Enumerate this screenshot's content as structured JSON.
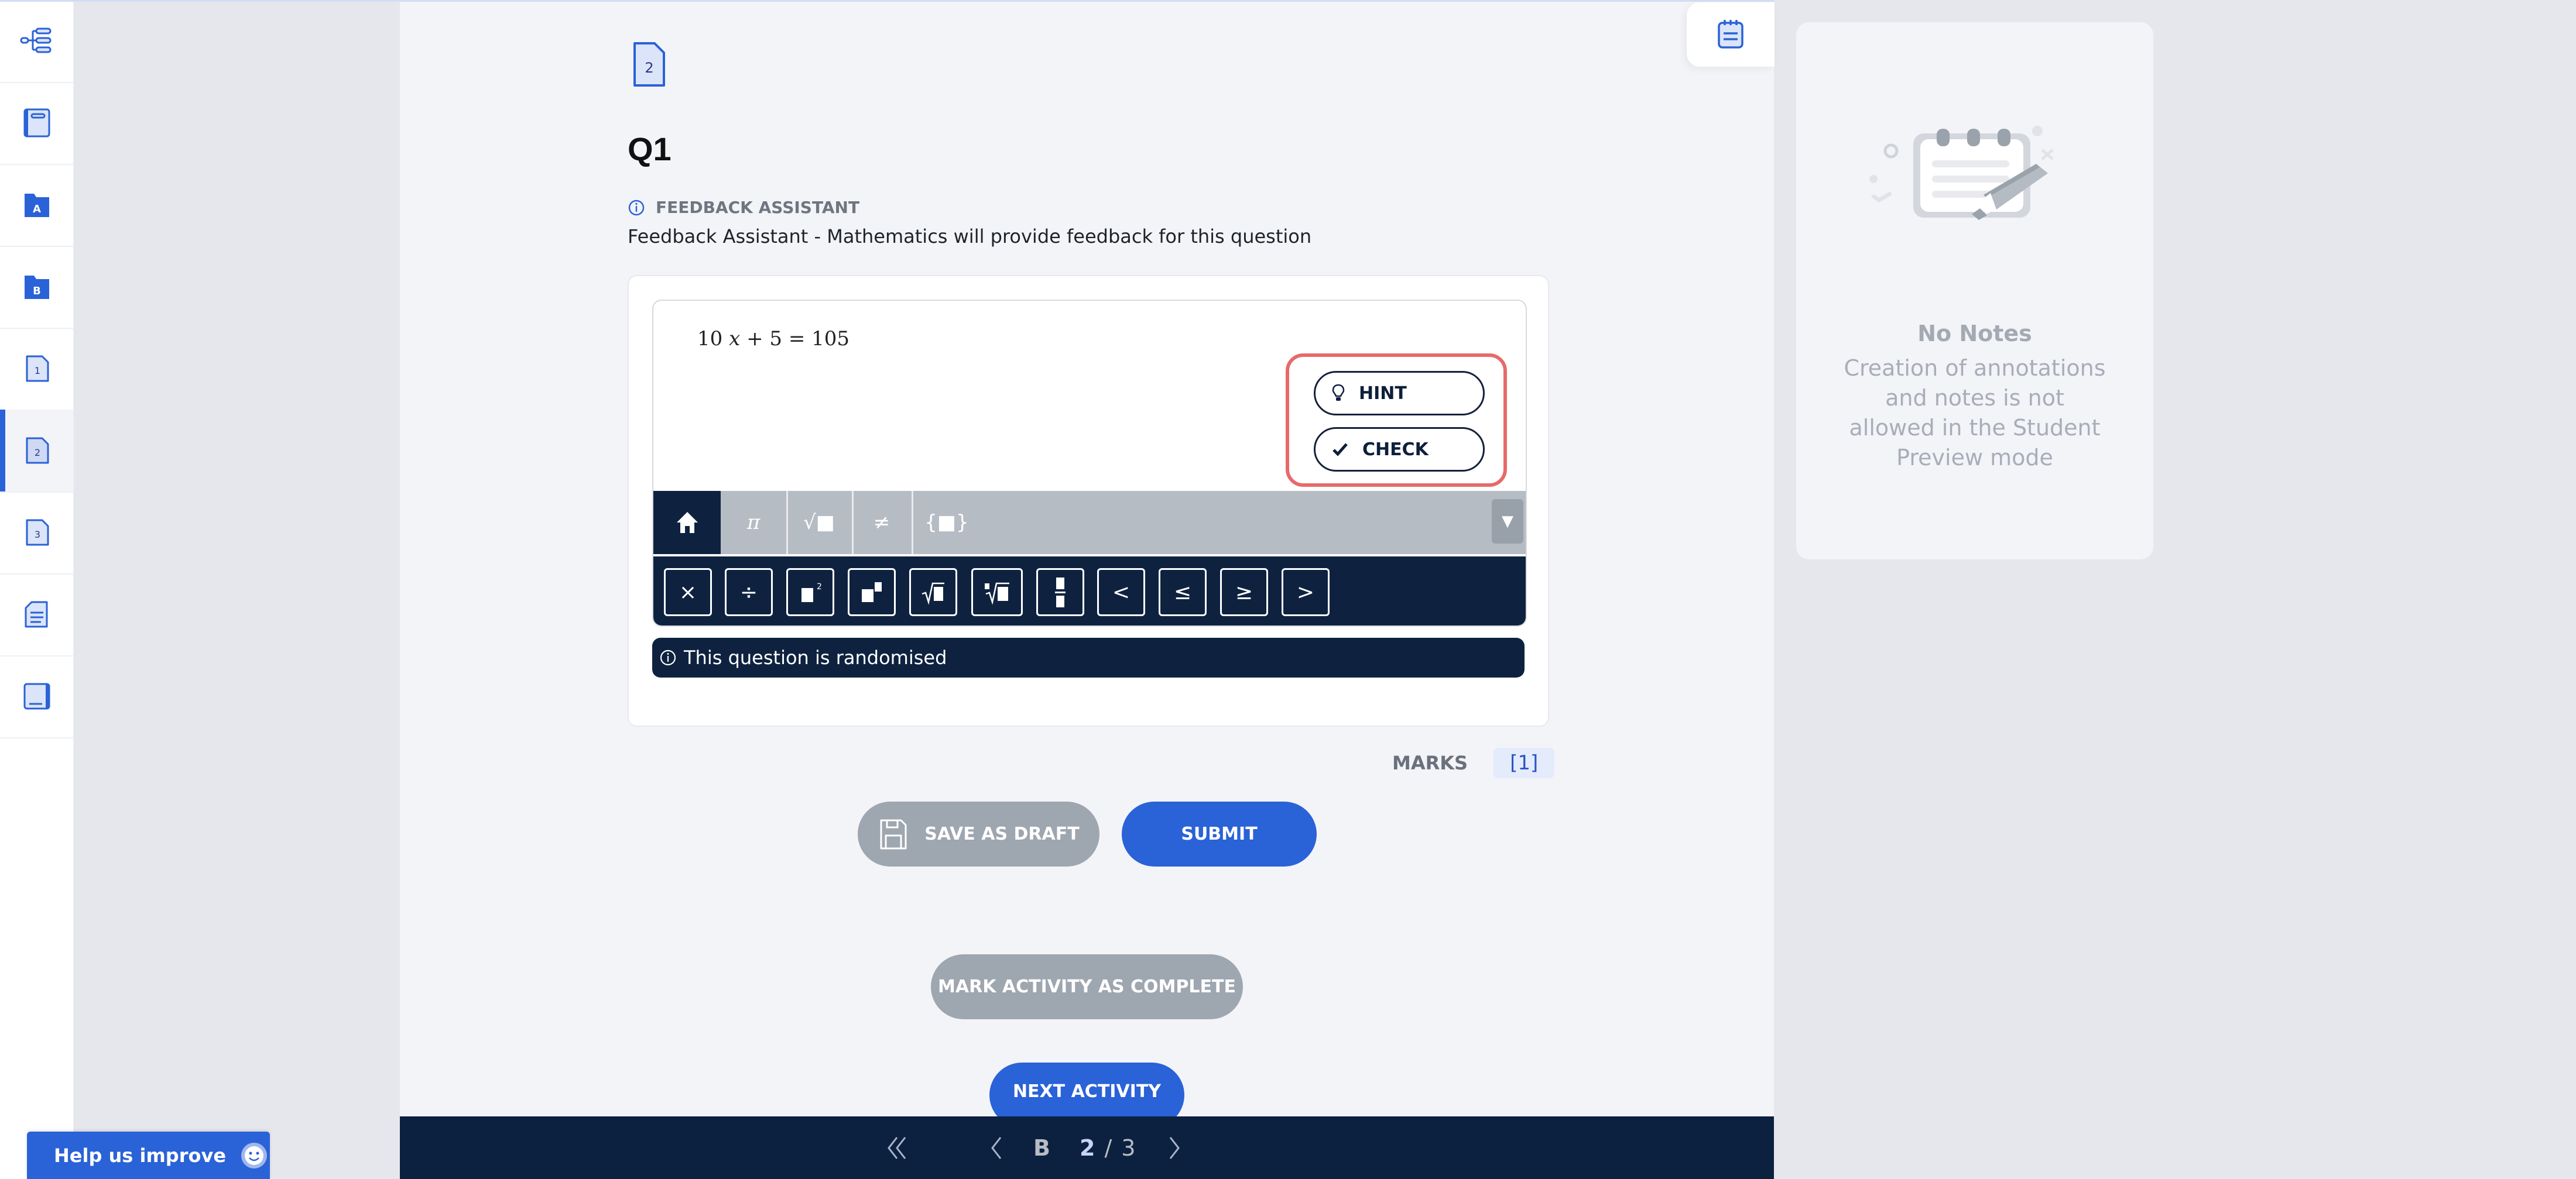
{
  "sidebar": {
    "items": [
      {
        "icon": "structure-tree-icon",
        "label": ""
      },
      {
        "icon": "book-icon",
        "label": ""
      },
      {
        "icon": "folder-a-icon",
        "label": "A"
      },
      {
        "icon": "folder-b-icon",
        "label": "B"
      },
      {
        "icon": "page-1-icon",
        "label": "1"
      },
      {
        "icon": "page-2-icon",
        "label": "2",
        "active": true
      },
      {
        "icon": "page-3-icon",
        "label": "3"
      },
      {
        "icon": "document-lines-icon",
        "label": ""
      },
      {
        "icon": "closed-book-icon",
        "label": ""
      }
    ]
  },
  "page": {
    "page_icon_label": "2",
    "question_title": "Q1",
    "feedback_label": "FEEDBACK ASSISTANT",
    "feedback_description": "Feedback Assistant - Mathematics will provide feedback for this question"
  },
  "editor": {
    "expression": {
      "coef": "10",
      "var": "x",
      "rest": "+ 5 = 105"
    },
    "hint_label": "HINT",
    "check_label": "CHECK",
    "tabs": [
      {
        "name": "home",
        "glyph": "⌂"
      },
      {
        "name": "pi",
        "glyph": "π"
      },
      {
        "name": "sqrt",
        "glyph": "√■"
      },
      {
        "name": "not-equal",
        "glyph": "≠"
      },
      {
        "name": "set-braces",
        "glyph": "{■}"
      }
    ],
    "dropdown_glyph": "▼",
    "keys": [
      {
        "name": "times",
        "glyph": "×"
      },
      {
        "name": "divide",
        "glyph": "÷"
      },
      {
        "name": "square",
        "glyph": "■²"
      },
      {
        "name": "power",
        "glyph": "■■"
      },
      {
        "name": "square-root",
        "glyph": "√■"
      },
      {
        "name": "nth-root",
        "glyph": "ⁿ√■"
      },
      {
        "name": "fraction",
        "glyph": "▬"
      },
      {
        "name": "less-than",
        "glyph": "<"
      },
      {
        "name": "less-equal",
        "glyph": "≤"
      },
      {
        "name": "greater-equal",
        "glyph": "≥"
      },
      {
        "name": "greater-than",
        "glyph": ">"
      }
    ],
    "randomised_notice": "This question is randomised"
  },
  "marks": {
    "label": "MARKS",
    "value": "[1]"
  },
  "actions": {
    "save_draft": "SAVE AS DRAFT",
    "submit": "SUBMIT",
    "mark_complete": "MARK ACTIVITY AS COMPLETE",
    "next_activity": "NEXT ACTIVITY"
  },
  "pager": {
    "section": "B",
    "current": "2",
    "separator": "/",
    "total": "3"
  },
  "notes": {
    "title": "No Notes",
    "description": "Creation of annotations and notes is not allowed in the Student Preview mode"
  },
  "help": {
    "label": "Help us improve"
  },
  "colors": {
    "accent": "#2a62d7",
    "navy": "#0c2140",
    "disabled": "#9ea6b0",
    "highlight": "#e66a6a"
  }
}
